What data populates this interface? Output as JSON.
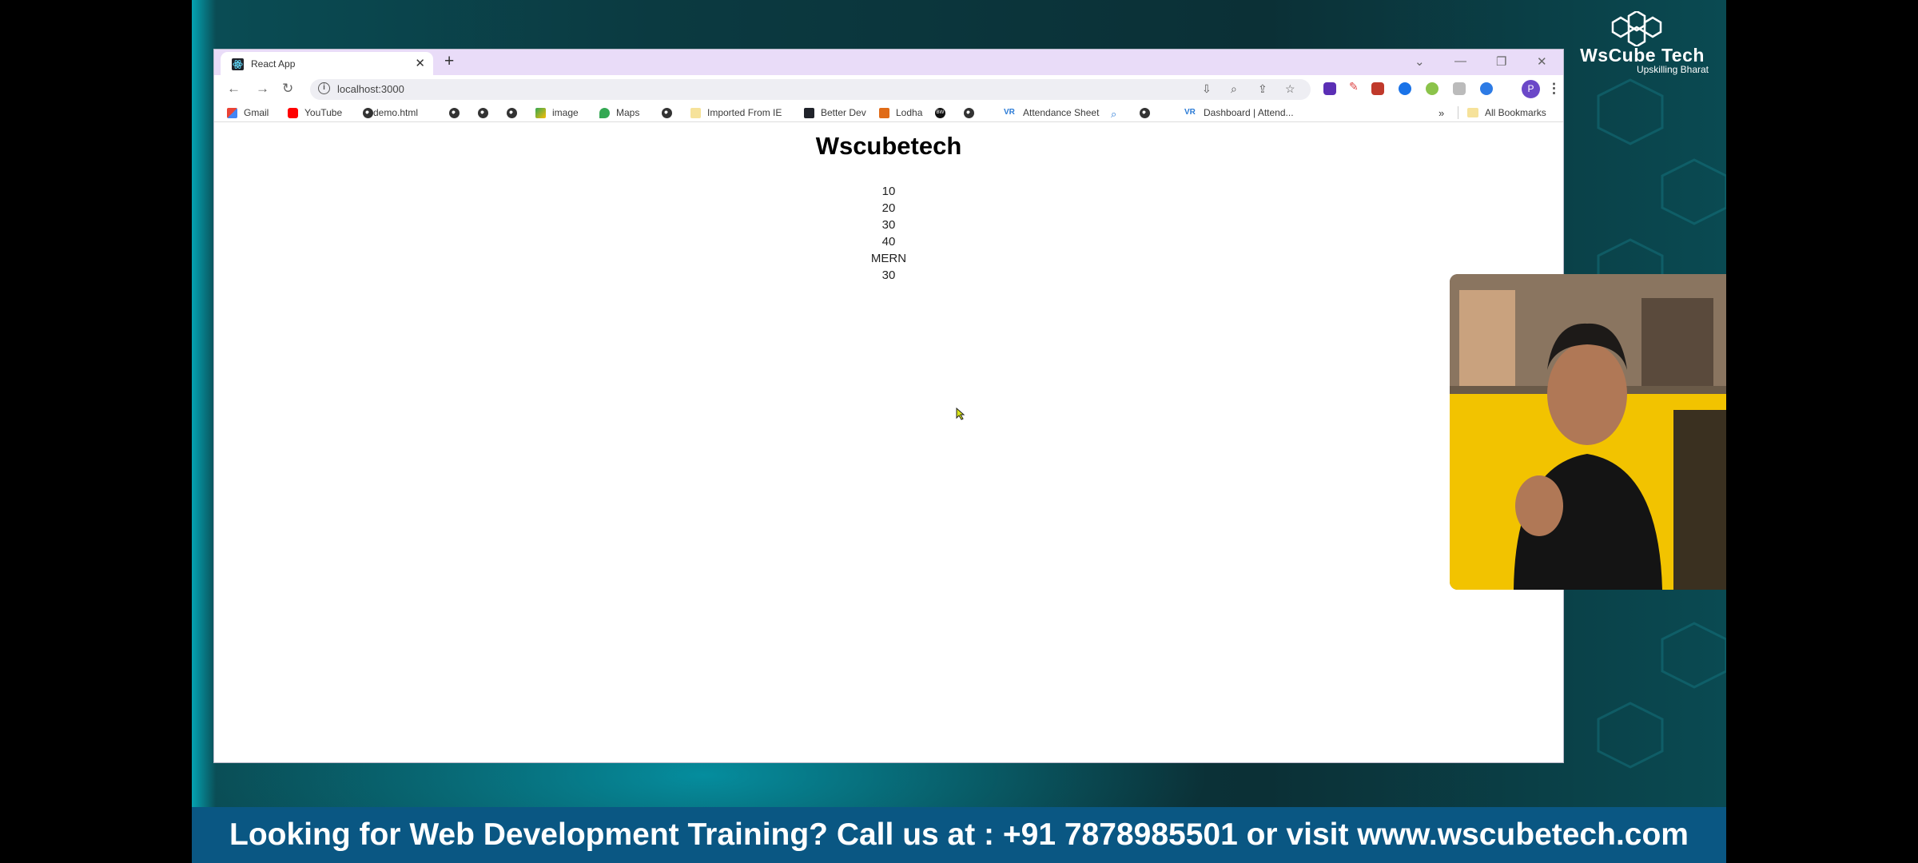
{
  "brand": {
    "name": "WsCube Tech",
    "tagline": "Upskilling Bharat"
  },
  "browser": {
    "tab_title": "React App",
    "url": "localhost:3000",
    "profile_initial": "P",
    "bookmarks": [
      {
        "label": "Gmail",
        "icon": "gmail-icon"
      },
      {
        "label": "YouTube",
        "icon": "youtube-icon"
      },
      {
        "label": "demo.html",
        "icon": "globe-icon"
      },
      {
        "label": "",
        "icon": "globe-icon"
      },
      {
        "label": "",
        "icon": "globe-icon"
      },
      {
        "label": "",
        "icon": "globe-icon"
      },
      {
        "label": "image",
        "icon": "image-icon"
      },
      {
        "label": "Maps",
        "icon": "maps-icon"
      },
      {
        "label": "",
        "icon": "globe-icon"
      },
      {
        "label": "Imported From IE",
        "icon": "folder-icon"
      },
      {
        "label": "Better Dev",
        "icon": "react-icon"
      },
      {
        "label": "Lodha",
        "icon": "lodha-icon"
      },
      {
        "label": "",
        "icon": "circle-icon"
      },
      {
        "label": "",
        "icon": "globe-icon"
      },
      {
        "label": "Attendance Sheet",
        "icon": "vr-icon"
      },
      {
        "label": "",
        "icon": "search-icon"
      },
      {
        "label": "",
        "icon": "globe-icon"
      },
      {
        "label": "Dashboard | Attend...",
        "icon": "vr-icon"
      }
    ],
    "overflow": "»",
    "all_bookmarks": "All Bookmarks",
    "vr_glyph": "VR",
    "circle_glyph": "BW"
  },
  "page": {
    "title": "Wscubetech",
    "items": [
      "10",
      "20",
      "30",
      "40",
      "MERN",
      "30"
    ]
  },
  "banner": {
    "text": "Looking for Web Development Training? Call us at : +91 7878985501 or visit www.wscubetech.com"
  },
  "colors": {
    "tab_bar": "#e9dcf8",
    "banner": "#0a5783",
    "background_teal": "#0b3a41"
  }
}
